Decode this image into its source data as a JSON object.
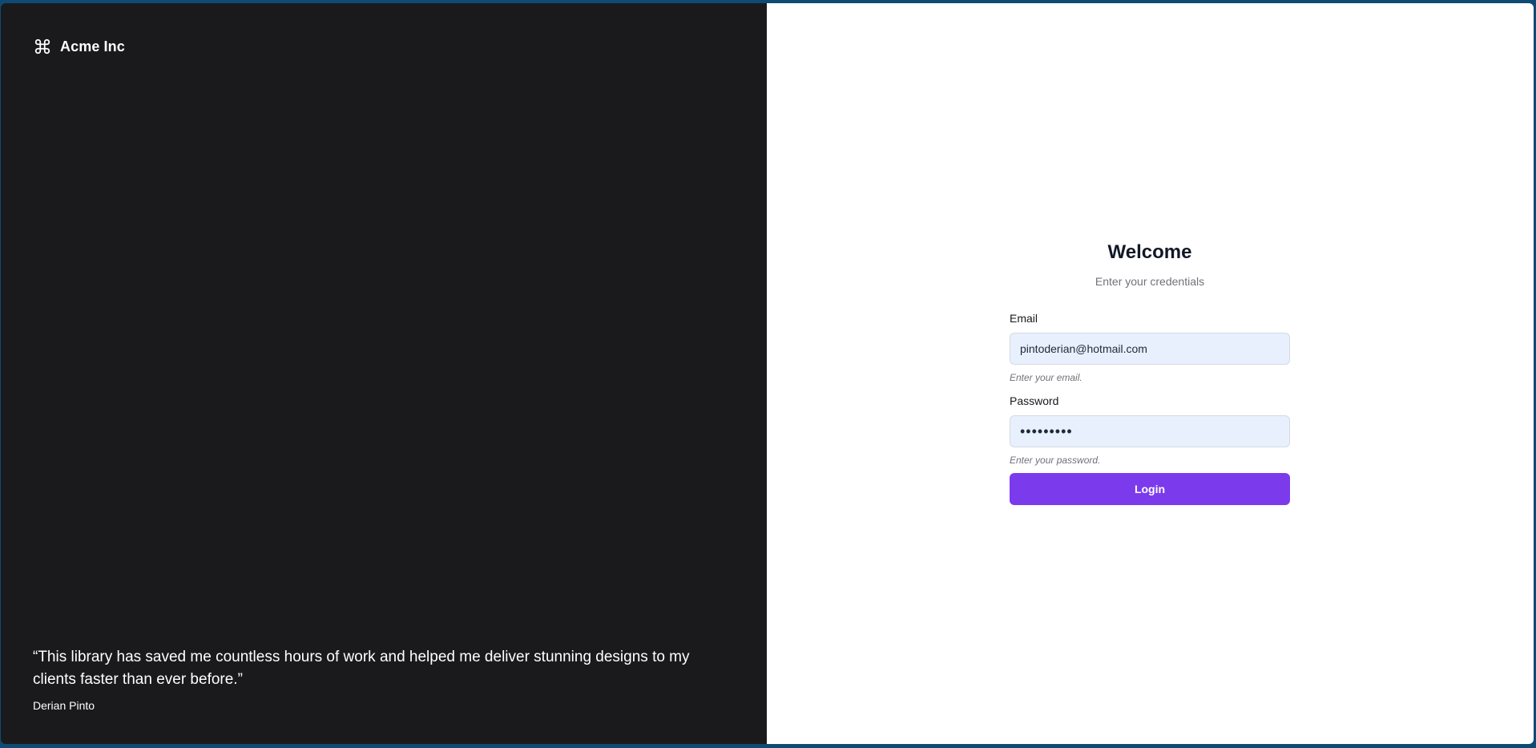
{
  "brand": {
    "name": "Acme Inc",
    "icon": "command-icon"
  },
  "testimonial": {
    "quote": "“This library has saved me countless hours of work and helped me deliver stunning designs to my clients faster than ever before.”",
    "author": "Derian Pinto"
  },
  "form": {
    "title": "Welcome",
    "subtitle": "Enter your credentials",
    "email": {
      "label": "Email",
      "value": "pintoderian@hotmail.com",
      "hint": "Enter your email."
    },
    "password": {
      "label": "Password",
      "value": "•••••••••",
      "hint": "Enter your password."
    },
    "submit_label": "Login"
  },
  "colors": {
    "left_panel_bg": "#1a1a1d",
    "accent": "#7c3aed",
    "input_bg": "#e8f0fe",
    "frame_border": "#0f4a74"
  }
}
